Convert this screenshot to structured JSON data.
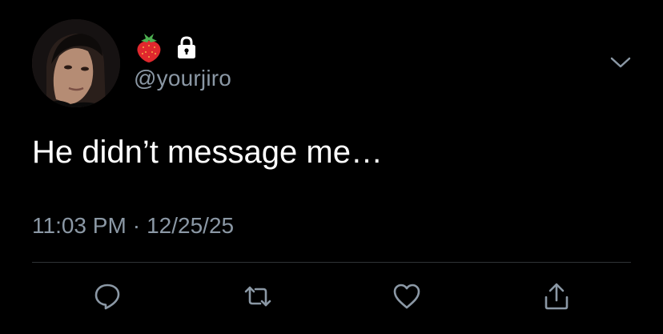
{
  "tweet": {
    "handle": "@yourjiro",
    "name_emoji": "strawberry-icon",
    "protected_icon": "lock-icon",
    "text": "He didn’t message me…",
    "time": "11:03 PM",
    "separator": "·",
    "date": "12/25/25"
  },
  "actions": [
    {
      "name": "reply",
      "icon": "reply-icon"
    },
    {
      "name": "retweet",
      "icon": "retweet-icon"
    },
    {
      "name": "like",
      "icon": "heart-icon"
    },
    {
      "name": "share",
      "icon": "share-icon"
    }
  ],
  "colors": {
    "background": "#000000",
    "text": "#ffffff",
    "secondary_text": "#8b98a5",
    "divider": "#2f3336"
  }
}
